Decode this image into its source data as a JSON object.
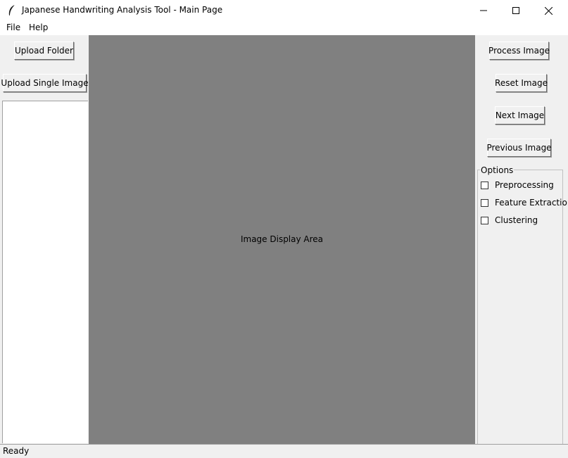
{
  "window": {
    "title": "Japanese Handwriting Analysis Tool - Main Page",
    "icon": "feather-icon",
    "controls": [
      "minimize-icon",
      "maximize-icon",
      "close-icon"
    ]
  },
  "menu": {
    "items": [
      {
        "label": "File"
      },
      {
        "label": "Help"
      }
    ]
  },
  "left_panel": {
    "upload_folder_label": "Upload Folder",
    "upload_single_label": "Upload Single Image",
    "file_list": []
  },
  "image_area": {
    "placeholder": "Image Display Area",
    "background_color": "#808080"
  },
  "right_panel": {
    "process_label": "Process Image",
    "reset_label": "Reset Image",
    "next_label": "Next Image",
    "previous_label": "Previous Image",
    "options": {
      "title": "Options",
      "items": [
        {
          "label": "Preprocessing",
          "checked": false
        },
        {
          "label": "Feature Extraction",
          "checked": false
        },
        {
          "label": "Clustering",
          "checked": false
        }
      ]
    }
  },
  "status": {
    "text": "Ready"
  }
}
